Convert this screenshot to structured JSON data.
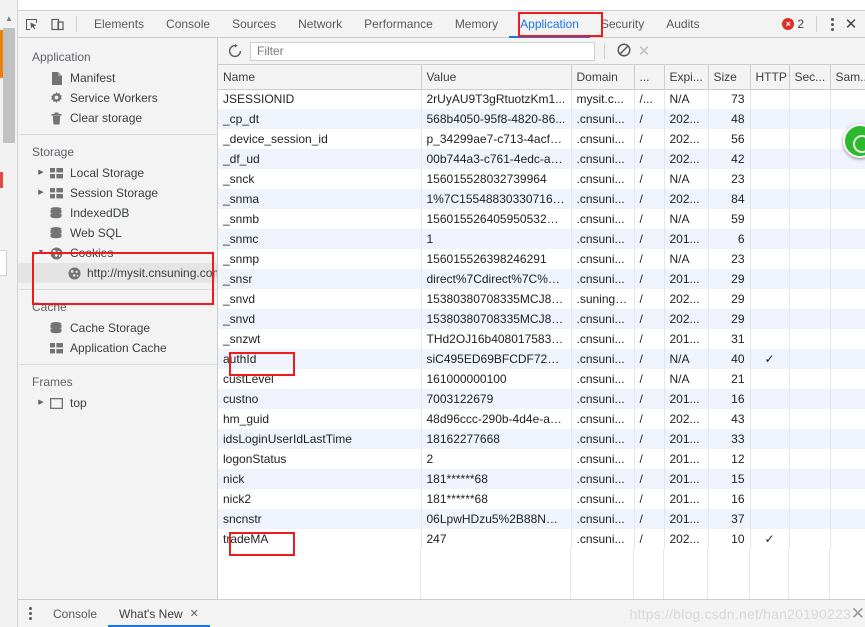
{
  "toolbar": {
    "icons": [
      {
        "name": "inspect-element-icon",
        "glyph": "⬉"
      },
      {
        "name": "device-toolbar-icon",
        "glyph": "▯"
      }
    ],
    "tabs": [
      {
        "label": "Elements",
        "active": false
      },
      {
        "label": "Console",
        "active": false
      },
      {
        "label": "Sources",
        "active": false
      },
      {
        "label": "Network",
        "active": false
      },
      {
        "label": "Performance",
        "active": false
      },
      {
        "label": "Memory",
        "active": false
      },
      {
        "label": "Application",
        "active": true
      },
      {
        "label": "Security",
        "active": false
      },
      {
        "label": "Audits",
        "active": false
      }
    ],
    "error_count": "2",
    "error_glyph": "×",
    "close_glyph": "✕"
  },
  "sidebar": {
    "groups": [
      {
        "title": "Application",
        "items": [
          {
            "label": "Manifest",
            "icon": "document-icon",
            "glyph": "▤",
            "arrow": "",
            "selected": false,
            "indent": 1
          },
          {
            "label": "Service Workers",
            "icon": "gear-icon",
            "glyph": "✹",
            "arrow": "",
            "selected": false,
            "indent": 1
          },
          {
            "label": "Clear storage",
            "icon": "trash-icon",
            "glyph": "▮",
            "arrow": "",
            "selected": false,
            "indent": 1
          }
        ]
      },
      {
        "title": "Storage",
        "items": [
          {
            "label": "Local Storage",
            "icon": "table-icon",
            "glyph": "▤",
            "arrow": "▶",
            "selected": false,
            "indent": 1
          },
          {
            "label": "Session Storage",
            "icon": "table-icon",
            "glyph": "▤",
            "arrow": "▶",
            "selected": false,
            "indent": 1
          },
          {
            "label": "IndexedDB",
            "icon": "database-icon",
            "glyph": "▤",
            "arrow": "",
            "selected": false,
            "indent": 1
          },
          {
            "label": "Web SQL",
            "icon": "database-icon",
            "glyph": "▤",
            "arrow": "",
            "selected": false,
            "indent": 1
          },
          {
            "label": "Cookies",
            "icon": "cookie-icon",
            "glyph": "◍",
            "arrow": "▼",
            "selected": false,
            "indent": 1
          },
          {
            "label": "http://mysit.cnsuning.com",
            "icon": "cookie-icon",
            "glyph": "◍",
            "arrow": "",
            "selected": true,
            "indent": 2
          }
        ]
      },
      {
        "title": "Cache",
        "items": [
          {
            "label": "Cache Storage",
            "icon": "database-icon",
            "glyph": "▤",
            "arrow": "",
            "selected": false,
            "indent": 1
          },
          {
            "label": "Application Cache",
            "icon": "table-icon",
            "glyph": "▤",
            "arrow": "",
            "selected": false,
            "indent": 1
          }
        ]
      },
      {
        "title": "Frames",
        "items": [
          {
            "label": "top",
            "icon": "frame-icon",
            "glyph": "▢",
            "arrow": "▶",
            "selected": false,
            "indent": 1
          }
        ]
      }
    ]
  },
  "filterbar": {
    "refresh_icon": "refresh-icon",
    "refresh_glyph": "⟳",
    "placeholder": "Filter",
    "value": "",
    "clear_all_icon": "clear-all-cookies-icon",
    "clear_all_glyph": "⊘",
    "clear_filtered_icon": "clear-filtered-icon",
    "clear_filtered_glyph": "✕"
  },
  "table": {
    "columns": [
      "Name",
      "Value",
      "Domain",
      "...",
      "Expi...",
      "Size",
      "HTTP",
      "Sec...",
      "Sam..."
    ],
    "rows": [
      {
        "name": "JSESSIONID",
        "value": "2rUyAU9T3gRtuotzKm1...",
        "domain": "mysit.c...",
        "path": "/...",
        "expires": "N/A",
        "size": "73",
        "http": "",
        "secure": "",
        "samesite": ""
      },
      {
        "name": "_cp_dt",
        "value": "568b4050-95f8-4820-86...",
        "domain": ".cnsuni...",
        "path": "/",
        "expires": "202...",
        "size": "48",
        "http": "",
        "secure": "",
        "samesite": ""
      },
      {
        "name": "_device_session_id",
        "value": "p_34299ae7-c713-4acf-b...",
        "domain": ".cnsuni...",
        "path": "/",
        "expires": "202...",
        "size": "56",
        "http": "",
        "secure": "",
        "samesite": ""
      },
      {
        "name": "_df_ud",
        "value": "00b744a3-c761-4edc-a9...",
        "domain": ".cnsuni...",
        "path": "/",
        "expires": "202...",
        "size": "42",
        "http": "",
        "secure": "",
        "samesite": ""
      },
      {
        "name": "_snck",
        "value": "156015528032739964",
        "domain": ".cnsuni...",
        "path": "/",
        "expires": "N/A",
        "size": "23",
        "http": "",
        "secure": "",
        "samesite": ""
      },
      {
        "name": "_snma",
        "value": "1%7C155488303307164...",
        "domain": ".cnsuni...",
        "path": "/",
        "expires": "202...",
        "size": "84",
        "http": "",
        "secure": "",
        "samesite": ""
      },
      {
        "name": "_snmb",
        "value": "156015526405950532%...",
        "domain": ".cnsuni...",
        "path": "/",
        "expires": "N/A",
        "size": "59",
        "http": "",
        "secure": "",
        "samesite": ""
      },
      {
        "name": "_snmc",
        "value": "1",
        "domain": ".cnsuni...",
        "path": "/",
        "expires": "201...",
        "size": "6",
        "http": "",
        "secure": "",
        "samesite": ""
      },
      {
        "name": "_snmp",
        "value": "156015526398246291",
        "domain": ".cnsuni...",
        "path": "/",
        "expires": "N/A",
        "size": "23",
        "http": "",
        "secure": "",
        "samesite": ""
      },
      {
        "name": "_snsr",
        "value": "direct%7Cdirect%7C%7C...",
        "domain": ".cnsuni...",
        "path": "/",
        "expires": "201...",
        "size": "29",
        "http": "",
        "secure": "",
        "samesite": ""
      },
      {
        "name": "_snvd",
        "value": "15380380708335MCJ8av...",
        "domain": ".suning....",
        "path": "/",
        "expires": "202...",
        "size": "29",
        "http": "",
        "secure": "",
        "samesite": ""
      },
      {
        "name": "_snvd",
        "value": "15380380708335MCJ8av...",
        "domain": ".cnsuni...",
        "path": "/",
        "expires": "202...",
        "size": "29",
        "http": "",
        "secure": "",
        "samesite": ""
      },
      {
        "name": "_snzwt",
        "value": "THd2OJ16b408017583y...",
        "domain": ".cnsuni...",
        "path": "/",
        "expires": "201...",
        "size": "31",
        "http": "",
        "secure": "",
        "samesite": ""
      },
      {
        "name": "authId",
        "value": "siC495ED69BFCDF725A3...",
        "domain": ".cnsuni...",
        "path": "/",
        "expires": "N/A",
        "size": "40",
        "http": "✓",
        "secure": "",
        "samesite": ""
      },
      {
        "name": "custLevel",
        "value": "161000000100",
        "domain": ".cnsuni...",
        "path": "/",
        "expires": "N/A",
        "size": "21",
        "http": "",
        "secure": "",
        "samesite": ""
      },
      {
        "name": "custno",
        "value": "7003122679",
        "domain": ".cnsuni...",
        "path": "/",
        "expires": "201...",
        "size": "16",
        "http": "",
        "secure": "",
        "samesite": ""
      },
      {
        "name": "hm_guid",
        "value": "48d96ccc-290b-4d4e-a1...",
        "domain": ".cnsuni...",
        "path": "/",
        "expires": "202...",
        "size": "43",
        "http": "",
        "secure": "",
        "samesite": ""
      },
      {
        "name": "idsLoginUserIdLastTime",
        "value": "18162277668",
        "domain": ".cnsuni...",
        "path": "/",
        "expires": "201...",
        "size": "33",
        "http": "",
        "secure": "",
        "samesite": ""
      },
      {
        "name": "logonStatus",
        "value": "2",
        "domain": ".cnsuni...",
        "path": "/",
        "expires": "201...",
        "size": "12",
        "http": "",
        "secure": "",
        "samesite": ""
      },
      {
        "name": "nick",
        "value": "181******68",
        "domain": ".cnsuni...",
        "path": "/",
        "expires": "201...",
        "size": "15",
        "http": "",
        "secure": "",
        "samesite": ""
      },
      {
        "name": "nick2",
        "value": "181******68",
        "domain": ".cnsuni...",
        "path": "/",
        "expires": "201...",
        "size": "16",
        "http": "",
        "secure": "",
        "samesite": ""
      },
      {
        "name": "sncnstr",
        "value": "06LpwHDzu5%2B88NGT...",
        "domain": ".cnsuni...",
        "path": "/",
        "expires": "201...",
        "size": "37",
        "http": "",
        "secure": "",
        "samesite": ""
      },
      {
        "name": "tradeMA",
        "value": "247",
        "domain": ".cnsuni...",
        "path": "/",
        "expires": "202...",
        "size": "10",
        "http": "✓",
        "secure": "",
        "samesite": ""
      }
    ]
  },
  "drawer": {
    "tabs": [
      {
        "label": "Console",
        "active": false,
        "closable": false
      },
      {
        "label": "What's New",
        "active": true,
        "closable": true
      }
    ],
    "close_glyph": "✕"
  },
  "watermark": {
    "text": "https://blog.csdn.net/han20190223",
    "close_glyph": "✕"
  },
  "annotations": {
    "highlight_color": "#ef1b1b",
    "boxes": [
      "application-tab",
      "cookies-origin",
      "authId-row-name",
      "tradeMA-row-name"
    ]
  }
}
